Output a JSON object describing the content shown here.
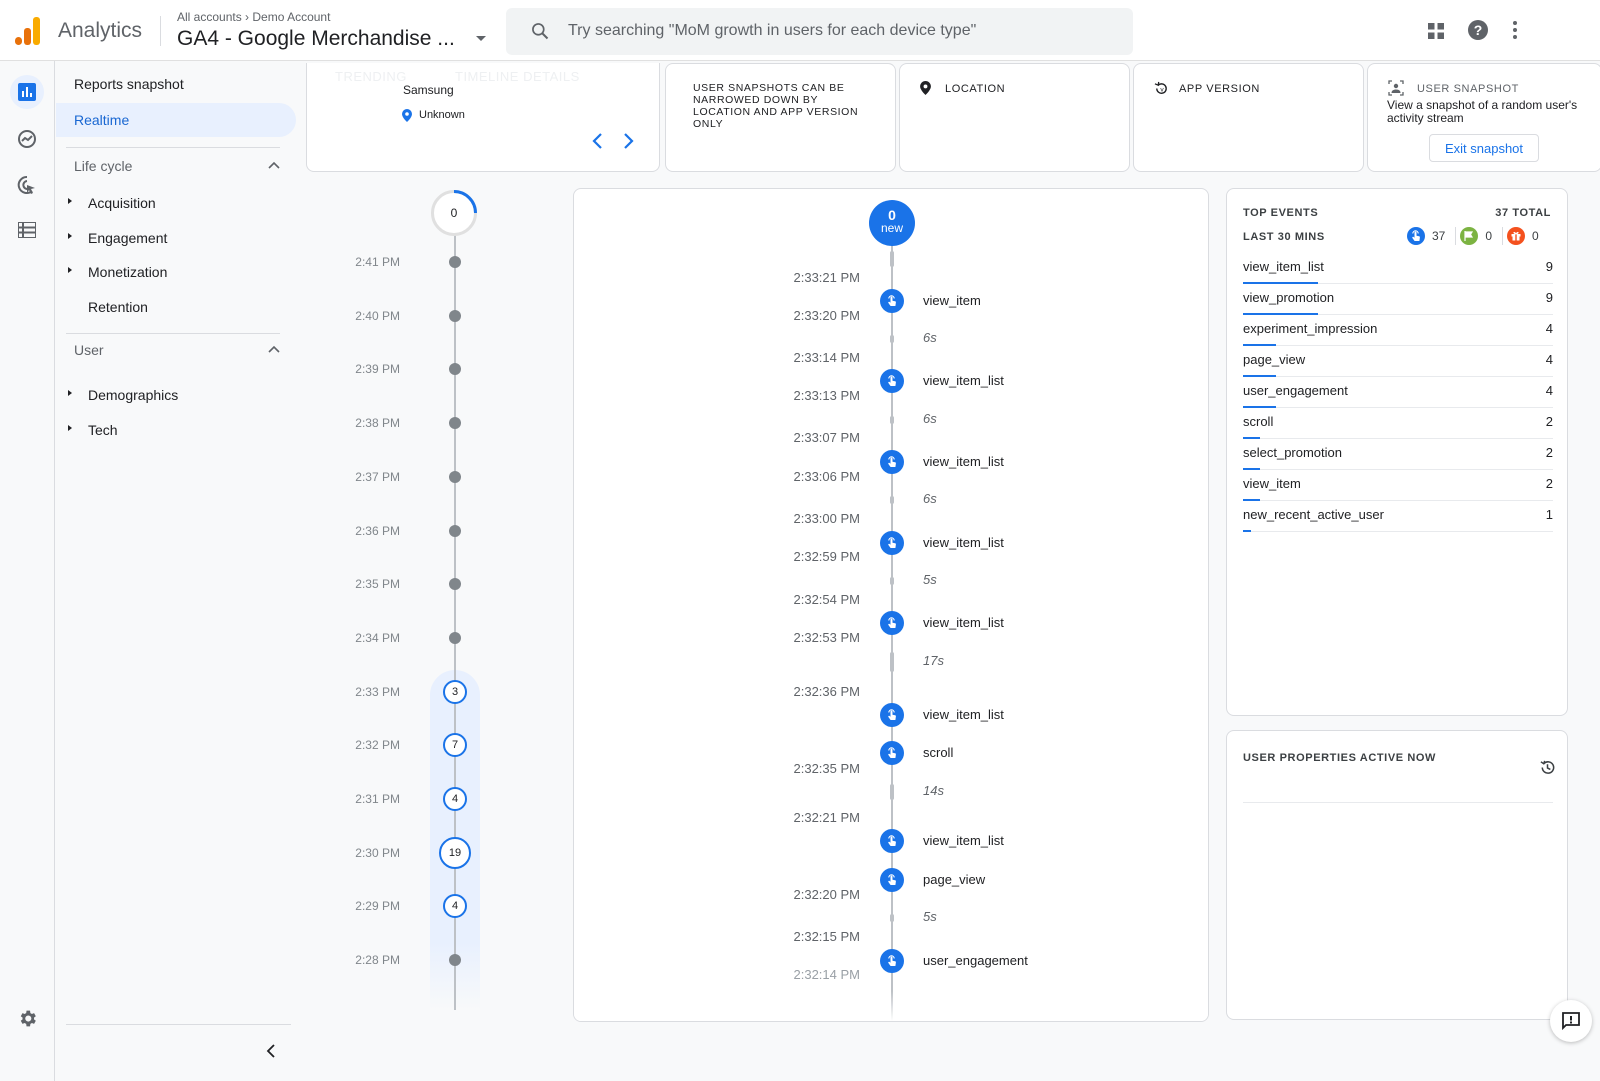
{
  "header": {
    "app_name": "Analytics",
    "breadcrumb_root": "All accounts",
    "breadcrumb_sep": "›",
    "breadcrumb_account": "Demo Account",
    "property_name": "GA4 - Google Merchandise ...",
    "search_placeholder": "Try searching \"MoM growth in users for each device type\""
  },
  "nav": {
    "reports_snapshot": "Reports snapshot",
    "realtime": "Realtime",
    "lifecycle_title": "Life cycle",
    "lifecycle_items": [
      "Acquisition",
      "Engagement",
      "Monetization",
      "Retention"
    ],
    "user_title": "User",
    "user_items": [
      "Demographics",
      "Tech"
    ]
  },
  "snapshot_cards": {
    "device": "Samsung",
    "location_value": "Unknown",
    "faded_tab_1": "TRENDING",
    "faded_tab_2": "TIMELINE DETAILS",
    "notice": "USER SNAPSHOTS CAN BE NARROWED DOWN BY LOCATION AND APP VERSION ONLY",
    "location_label": "LOCATION",
    "app_version_label": "APP VERSION",
    "user_snapshot_label": "USER SNAPSHOT",
    "user_snapshot_desc": "View a snapshot of a random user's activity stream",
    "exit_button": "Exit snapshot"
  },
  "minute_timeline": {
    "current_count": "0",
    "minutes": [
      {
        "label": "2:41 PM",
        "count": null
      },
      {
        "label": "2:40 PM",
        "count": null
      },
      {
        "label": "2:39 PM",
        "count": null
      },
      {
        "label": "2:38 PM",
        "count": null
      },
      {
        "label": "2:37 PM",
        "count": null
      },
      {
        "label": "2:36 PM",
        "count": null
      },
      {
        "label": "2:35 PM",
        "count": null
      },
      {
        "label": "2:34 PM",
        "count": null
      },
      {
        "label": "2:33 PM",
        "count": "3"
      },
      {
        "label": "2:32 PM",
        "count": "7"
      },
      {
        "label": "2:31 PM",
        "count": "4"
      },
      {
        "label": "2:30 PM",
        "count": "19"
      },
      {
        "label": "2:29 PM",
        "count": "4"
      },
      {
        "label": "2:28 PM",
        "count": null
      }
    ]
  },
  "event_stream": {
    "new_count": "0",
    "new_label": "new",
    "times": [
      "2:33:21 PM",
      "2:33:20 PM",
      "2:33:14 PM",
      "2:33:13 PM",
      "2:33:07 PM",
      "2:33:06 PM",
      "2:33:00 PM",
      "2:32:59 PM",
      "2:32:54 PM",
      "2:32:53 PM",
      "2:32:36 PM",
      "2:32:35 PM",
      "2:32:21 PM",
      "2:32:20 PM",
      "2:32:15 PM",
      "2:32:14 PM"
    ],
    "events": [
      "view_item",
      "view_item_list",
      "view_item_list",
      "view_item_list",
      "view_item_list",
      "view_item_list",
      "scroll",
      "view_item_list",
      "page_view",
      "user_engagement"
    ],
    "gaps": [
      "6s",
      "6s",
      "6s",
      "5s",
      "17s",
      "14s",
      "5s"
    ]
  },
  "top_events": {
    "title": "TOP EVENTS",
    "total": "37 TOTAL",
    "period": "LAST 30 MINS",
    "counts": {
      "events": "37",
      "conversions": "0",
      "purchases": "0"
    },
    "colors": {
      "events": "#1a73e8",
      "conversions": "#7cb342",
      "purchases": "#f4511e"
    },
    "rows": [
      {
        "name": "view_item_list",
        "value": "9"
      },
      {
        "name": "view_promotion",
        "value": "9"
      },
      {
        "name": "experiment_impression",
        "value": "4"
      },
      {
        "name": "page_view",
        "value": "4"
      },
      {
        "name": "user_engagement",
        "value": "4"
      },
      {
        "name": "scroll",
        "value": "2"
      },
      {
        "name": "select_promotion",
        "value": "2"
      },
      {
        "name": "view_item",
        "value": "2"
      },
      {
        "name": "new_recent_active_user",
        "value": "1"
      }
    ]
  },
  "user_properties": {
    "title": "USER PROPERTIES ACTIVE NOW"
  }
}
